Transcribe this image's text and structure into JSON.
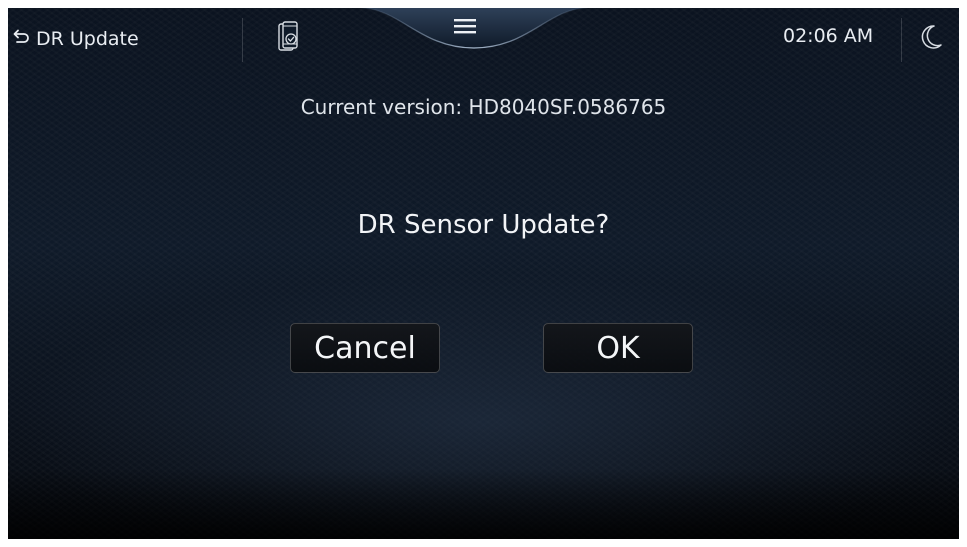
{
  "header": {
    "back_label": "DR Update",
    "time": "02:06 AM",
    "icons": [
      "back-arrow-icon",
      "phone-check-icon",
      "hamburger-menu-icon",
      "moon-icon"
    ]
  },
  "dialog": {
    "version_text": "Current version: HD8040SF.0586765",
    "question": "DR Sensor Update?",
    "cancel_label": "Cancel",
    "ok_label": "OK"
  },
  "colors": {
    "background": "#0f1a29",
    "text": "#f2f4f7",
    "button_bg": "#111317",
    "button_border": "#5a5f66"
  }
}
